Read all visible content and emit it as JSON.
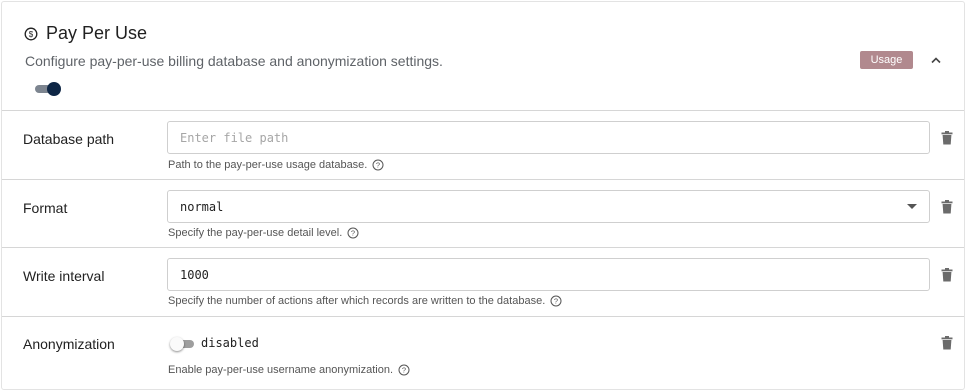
{
  "header": {
    "title": "Pay Per Use",
    "title_icon": "dollar-circle-icon",
    "subtitle": "Configure pay-per-use billing database and anonymization settings.",
    "badge": "Usage",
    "badge_color": "#b1898e",
    "enabled": true,
    "toggle_color": "#0e2645"
  },
  "fields": {
    "database_path": {
      "label": "Database path",
      "value": "",
      "placeholder": "Enter file path",
      "helper": "Path to the pay-per-use usage database."
    },
    "format": {
      "label": "Format",
      "value": "normal",
      "helper": "Specify the pay-per-use detail level."
    },
    "write_interval": {
      "label": "Write interval",
      "value": "1000",
      "helper": "Specify the number of actions after which records are written to the database."
    },
    "anonymization": {
      "label": "Anonymization",
      "enabled": false,
      "status": "disabled",
      "helper": "Enable pay-per-use username anonymization."
    }
  },
  "icons": {
    "delete": "trash-icon",
    "help": "help-circle-icon",
    "collapse": "chevron-up-icon",
    "dropdown": "caret-down-icon"
  }
}
